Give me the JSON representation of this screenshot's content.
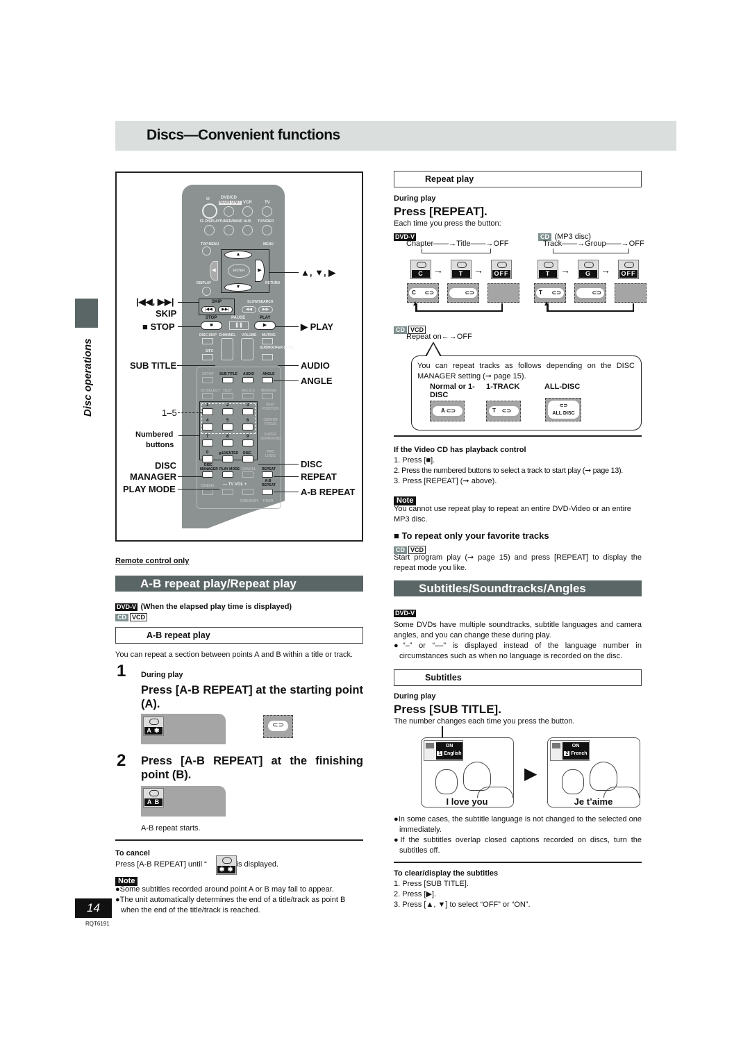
{
  "header": {
    "title": "Discs—Convenient functions"
  },
  "sidebar": {
    "label": "Disc operations"
  },
  "remote": {
    "callouts_left": {
      "skip_symbols": "|◀◀, ▶▶|",
      "skip": "SKIP",
      "stop": "■ STOP",
      "sub_title": "SUB TITLE",
      "one_to_five": "1–5",
      "numbered": "Numbered",
      "buttons": "buttons",
      "disc": "DISC",
      "manager": "MANAGER",
      "play_mode": "PLAY MODE"
    },
    "callouts_right": {
      "arrows": "▲, ▼, ▶",
      "play": "▶ PLAY",
      "audio": "AUDIO",
      "angle": "ANGLE",
      "disc": "DISC",
      "repeat": "REPEAT",
      "ab_repeat": "A-B REPEAT"
    },
    "keys": {
      "dvdcd": "DVD/CD",
      "main_unit": "MAIN UNIT",
      "vcr": "VCR",
      "tv": "TV",
      "fl_display": "FL DISPLAY",
      "tuner_band": "TUNER/BAND",
      "aux": "AUX",
      "tv_video": "TV/VIDEO",
      "top_menu": "TOP MENU",
      "menu": "MENU",
      "enter": "ENTER",
      "display": "DISPLAY",
      "return": "RETURN",
      "skip": "SKIP",
      "slow_search": "SLOW/SEARCH",
      "stop": "STOP",
      "pause": "PAUSE",
      "play": "PLAY",
      "disc_skip": "DISC SKIP",
      "channel": "CHANNEL",
      "volume": "VOLUME",
      "muting": "MUTING",
      "sfc": "S/FC",
      "subwoofer": "SUBWOOFER LEVEL",
      "setup": "SETUP",
      "sub_title": "SUB TITLE",
      "audio": "AUDIO",
      "angle": "ANGLE",
      "ch_select": "Ch SELECT",
      "test": "TEST",
      "mix2ch": "MIX 2ch",
      "marker": "MARKER",
      "seat_position": "SEAT POSITION",
      "center_focus": "CENTER FOCUS",
      "super_surround": "SUPER SURROUND",
      "pro_logic": "PRO LOGIC",
      "numbers": [
        "1",
        "2",
        "3",
        "4",
        "5",
        "6",
        "7",
        "8",
        "9",
        "0"
      ],
      "ten_enter": "≧10/ENTER",
      "disc": "DISC",
      "disc_manager": "DISC MANAGER",
      "play_mode": "PLAY MODE",
      "cancel": "CANCEL",
      "repeat": "REPEAT",
      "cinema": "CINEMA",
      "tv_vol": "— TV VOL +",
      "ab_repeat": "A-B REPEAT",
      "p_memory": "P.MEMORY",
      "timer": "TIMER"
    }
  },
  "left": {
    "remote_only": "Remote control only",
    "section_title": "A-B repeat play/Repeat play",
    "tag_dvdv": "DVD-V",
    "tag_note": "(When the elapsed play time is displayed)",
    "tag_cd": "CD",
    "tag_vcd": "VCD",
    "ab_header": "A-B repeat play",
    "ab_intro": "You can repeat a section between points A and B within a title or track.",
    "step1_num": "1",
    "step1_during": "During play",
    "step1_text": "Press [A-B REPEAT] at the starting point (A).",
    "step1_osd": "A ✱",
    "step2_num": "2",
    "step2_text": "Press [A-B REPEAT] at the finishing point (B).",
    "step2_osd": "A B",
    "ab_starts": "A-B repeat starts.",
    "cancel_title": "To cancel",
    "cancel_pre": "Press [A-B REPEAT] until “",
    "cancel_post": "” is displayed.",
    "cancel_osd": "✱ ✱",
    "note_label": "Note",
    "notes": [
      "●Some subtitles recorded around point A or B may fail to appear.",
      "●The unit automatically determines the end of a title/track as point B when the end of the title/track is reached."
    ]
  },
  "right": {
    "repeat_header": "Repeat play",
    "during_play": "During play",
    "press_repeat": "Press [REPEAT].",
    "each_time": "Each time you press the button:",
    "dvdv_tag": "DVD-V",
    "dvdv_seq": [
      "Chapter",
      "Title",
      "OFF"
    ],
    "dvdv_osd": [
      "C",
      "T",
      "OFF"
    ],
    "dvdv_bar": [
      "C",
      "",
      ""
    ],
    "cd_tag": "CD",
    "mp3_label": "(MP3 disc)",
    "mp3_seq": [
      "Track",
      "Group",
      "OFF"
    ],
    "mp3_osd": [
      "T",
      "G",
      "OFF"
    ],
    "mp3_bar": [
      "T",
      "",
      ""
    ],
    "cdvcd_cd": "CD",
    "cdvcd_vcd": "VCD",
    "repeat_on_off": "Repeat on←→OFF",
    "balloon_text": "You can repeat tracks as follows depending on the DISC MANAGER setting (➞ page 15).",
    "balloon_cols": [
      {
        "label": "Normal or 1-DISC",
        "osd": "A"
      },
      {
        "label": "1-TRACK",
        "osd": "T"
      },
      {
        "label": "ALL-DISC",
        "osd": "ALL DISC"
      }
    ],
    "vcd_pbc_title": "If the Video CD has playback control",
    "vcd_pbc_steps": [
      "1.  Press [■].",
      "2.  Press the numbered buttons to select a track to start play (➞ page 13).",
      "3.  Press [REPEAT] (➞ above)."
    ],
    "note_label": "Note",
    "note_text": "You cannot use repeat play to repeat an entire DVD-Video or an entire MP3 disc.",
    "fav_title": "■ To repeat only your favorite tracks",
    "fav_cd": "CD",
    "fav_vcd": "VCD",
    "fav_text": "Start program play (➞ page 15) and press [REPEAT] to display the repeat mode you like.",
    "sub_section_title": "Subtitles/Soundtracks/Angles",
    "sub_tag": "DVD-V",
    "sub_intro": "Some DVDs have multiple soundtracks, subtitle languages and camera angles, and you can change these during play.",
    "sub_bullet": "●“–” or “––” is displayed instead of the language number in circumstances such as when no language is recorded on the disc.",
    "subtitles_header": "Subtitles",
    "sub_during": "During play",
    "press_sub": "Press [SUB TITLE].",
    "number_changes": "The number changes each time you press the button.",
    "scenes": [
      {
        "on": "ON",
        "num": "1",
        "lang": "English",
        "caption": "I love you"
      },
      {
        "on": "ON",
        "num": "2",
        "lang": "French",
        "caption": "Je t’aime"
      }
    ],
    "bullets": [
      "●In some cases, the subtitle language is not changed to the selected one immediately.",
      "●If the subtitles overlap closed captions recorded on discs, turn the subtitles off."
    ],
    "clear_title": "To clear/display the subtitles",
    "clear_steps": [
      "1.  Press [SUB TITLE].",
      "2.  Press [▶].",
      "3.  Press [▲, ▼] to select “OFF” or “ON”."
    ]
  },
  "footer": {
    "page_number": "14",
    "code": "RQT6191"
  }
}
